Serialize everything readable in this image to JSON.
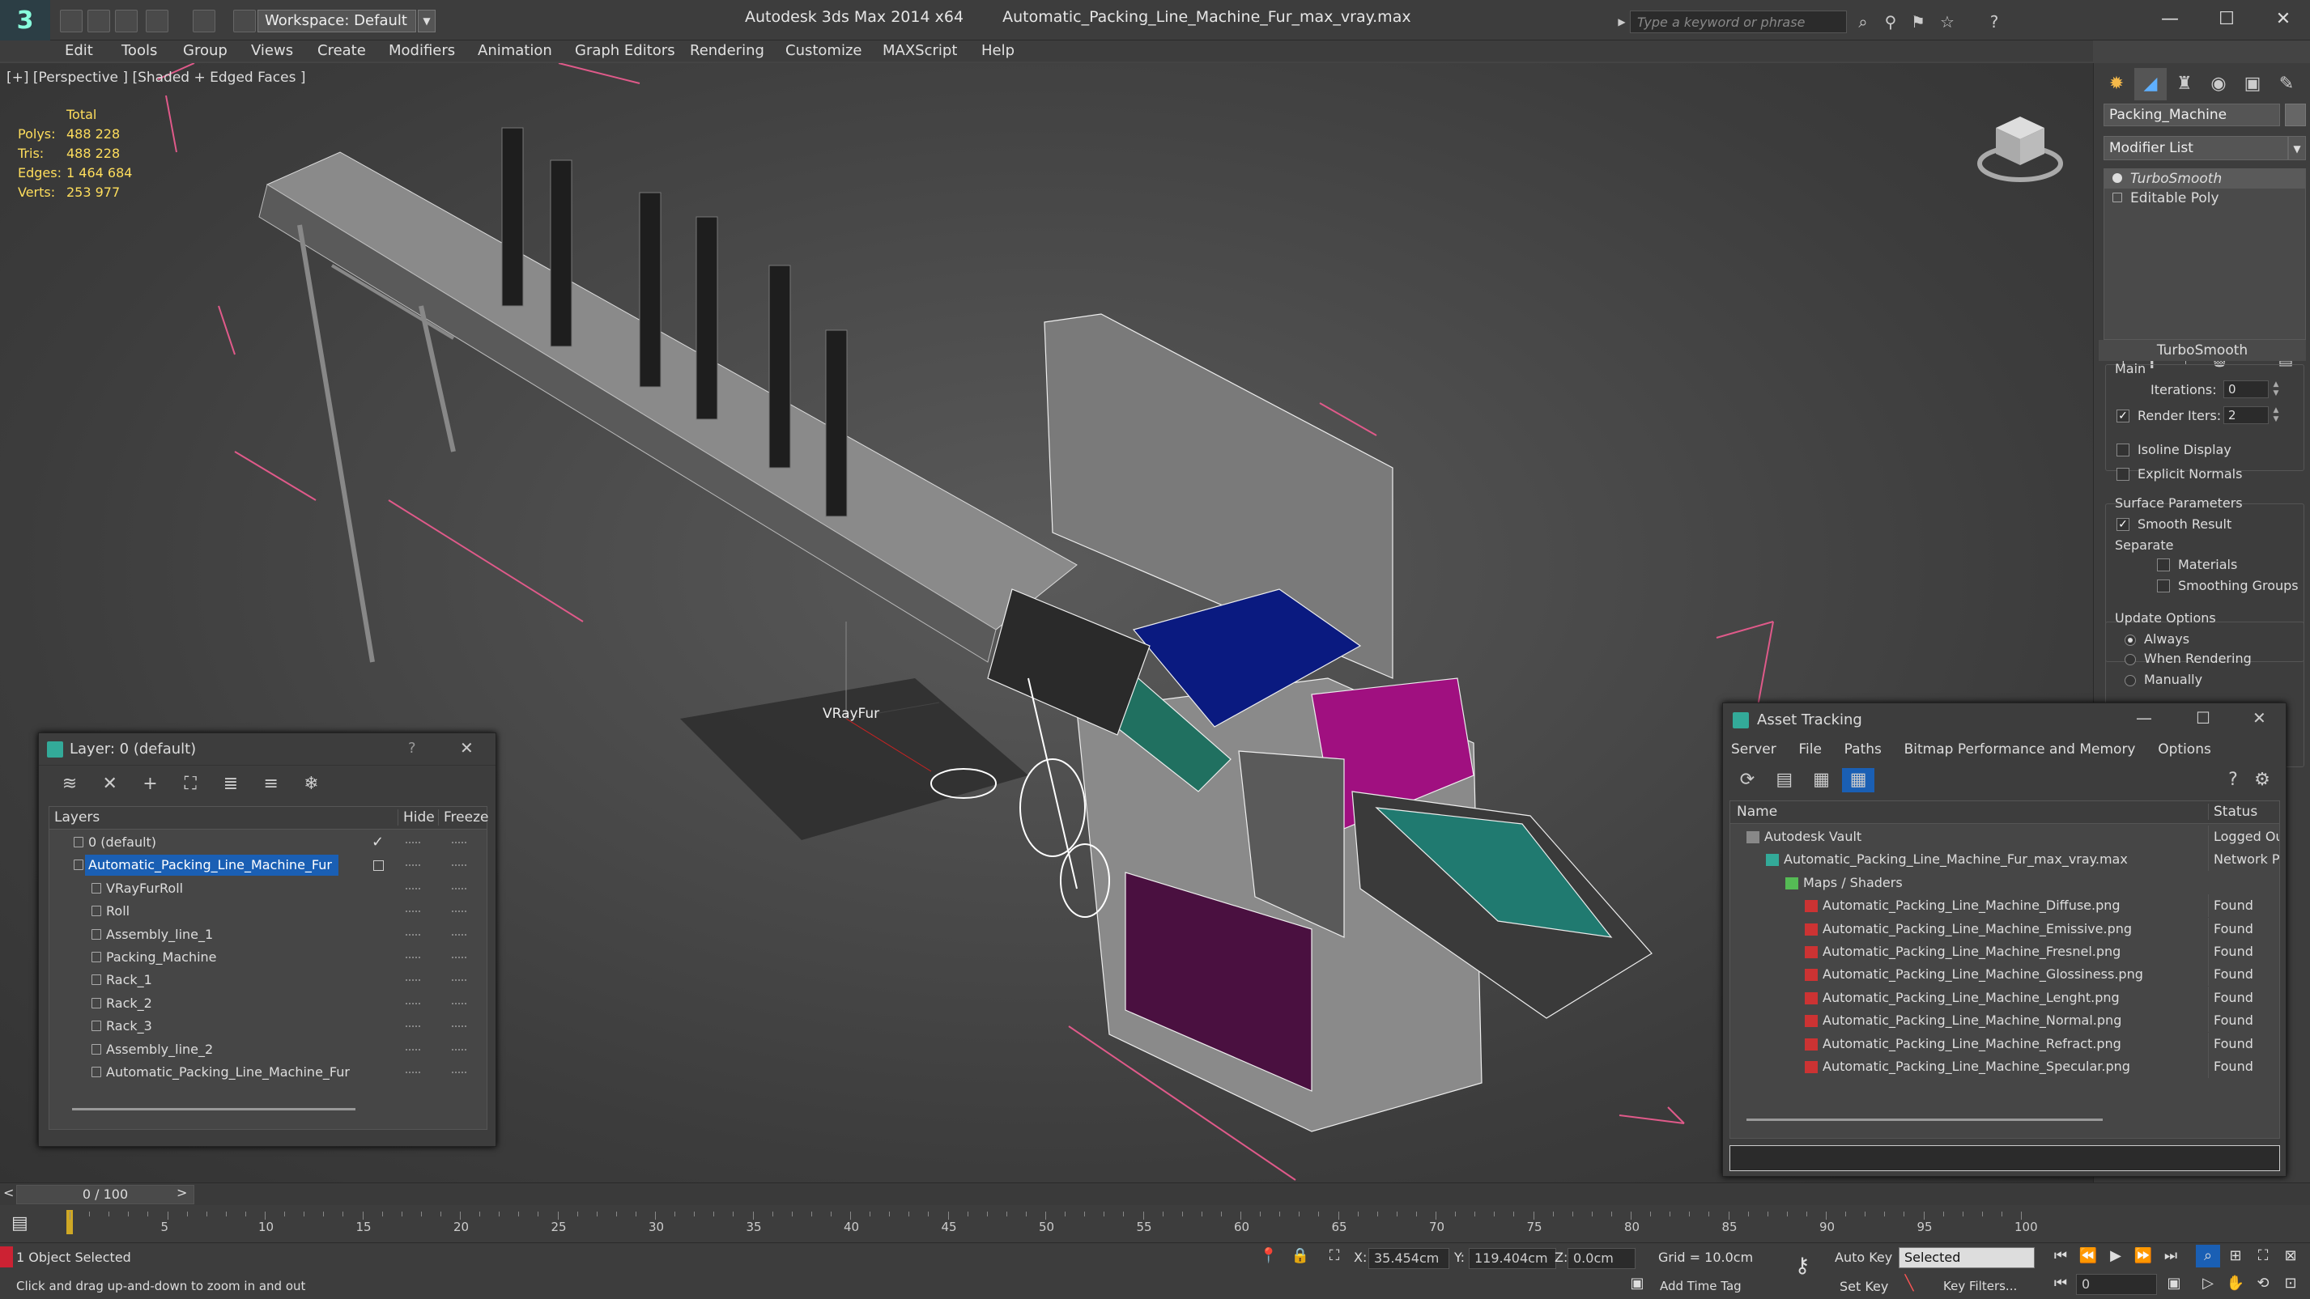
{
  "titlebar": {
    "workspace": "Workspace: Default",
    "app_name": "Autodesk 3ds Max  2014 x64",
    "file_name": "Automatic_Packing_Line_Machine_Fur_max_vray.max",
    "search_placeholder": "Type a keyword or phrase"
  },
  "menu": [
    "Edit",
    "Tools",
    "Group",
    "Views",
    "Create",
    "Modifiers",
    "Animation",
    "Graph Editors",
    "Rendering",
    "Customize",
    "MAXScript",
    "Help"
  ],
  "viewport": {
    "label": "[+] [Perspective ] [Shaded + Edged Faces ]",
    "stats_header": "Total",
    "stats": [
      {
        "k": "Polys:",
        "v": "488 228"
      },
      {
        "k": "Tris:",
        "v": "488 228"
      },
      {
        "k": "Edges:",
        "v": "1 464 684"
      },
      {
        "k": "Verts:",
        "v": "253 977"
      }
    ],
    "object_label": "VRayFur"
  },
  "command_panel": {
    "object_name": "Packing_Machine",
    "modifier_list": "Modifier List",
    "stack": [
      "TurboSmooth",
      "Editable Poly"
    ],
    "rollout_title": "TurboSmooth",
    "main_label": "Main",
    "iterations_label": "Iterations:",
    "iterations_value": "0",
    "render_iters_label": "Render Iters:",
    "render_iters_value": "2",
    "isoline": "Isoline Display",
    "explicit_normals": "Explicit Normals",
    "surface_params": "Surface Parameters",
    "smooth_result": "Smooth Result",
    "separate": "Separate",
    "materials": "Materials",
    "smoothing_groups": "Smoothing Groups",
    "update_options": "Update Options",
    "always": "Always",
    "when_rendering": "When Rendering",
    "manually": "Manually"
  },
  "layer_window": {
    "title": "Layer: 0 (default)",
    "help": "?",
    "col_layers": "Layers",
    "col_hide": "Hide",
    "col_freeze": "Freeze",
    "rows": [
      {
        "name": "0 (default)",
        "indent": 0
      },
      {
        "name": "Automatic_Packing_Line_Machine_Fur",
        "indent": 0
      },
      {
        "name": "VRayFurRoll",
        "indent": 1
      },
      {
        "name": "Roll",
        "indent": 1
      },
      {
        "name": "Assembly_line_1",
        "indent": 1
      },
      {
        "name": "Packing_Machine",
        "indent": 1
      },
      {
        "name": "Rack_1",
        "indent": 1
      },
      {
        "name": "Rack_2",
        "indent": 1
      },
      {
        "name": "Rack_3",
        "indent": 1
      },
      {
        "name": "Assembly_line_2",
        "indent": 1
      },
      {
        "name": "Automatic_Packing_Line_Machine_Fur",
        "indent": 1
      }
    ]
  },
  "asset_window": {
    "title": "Asset Tracking",
    "menu": [
      "Server",
      "File",
      "Paths",
      "Bitmap Performance and Memory",
      "Options"
    ],
    "col_name": "Name",
    "col_status": "Status",
    "rows": [
      {
        "name": "Autodesk Vault",
        "status": "Logged Ou",
        "indent": 0
      },
      {
        "name": "Automatic_Packing_Line_Machine_Fur_max_vray.max",
        "status": "Network Pa",
        "indent": 1
      },
      {
        "name": "Maps / Shaders",
        "status": "",
        "indent": 2
      },
      {
        "name": "Automatic_Packing_Line_Machine_Diffuse.png",
        "status": "Found",
        "indent": 3
      },
      {
        "name": "Automatic_Packing_Line_Machine_Emissive.png",
        "status": "Found",
        "indent": 3
      },
      {
        "name": "Automatic_Packing_Line_Machine_Fresnel.png",
        "status": "Found",
        "indent": 3
      },
      {
        "name": "Automatic_Packing_Line_Machine_Glossiness.png",
        "status": "Found",
        "indent": 3
      },
      {
        "name": "Automatic_Packing_Line_Machine_Lenght.png",
        "status": "Found",
        "indent": 3
      },
      {
        "name": "Automatic_Packing_Line_Machine_Normal.png",
        "status": "Found",
        "indent": 3
      },
      {
        "name": "Automatic_Packing_Line_Machine_Refract.png",
        "status": "Found",
        "indent": 3
      },
      {
        "name": "Automatic_Packing_Line_Machine_Specular.png",
        "status": "Found",
        "indent": 3
      }
    ]
  },
  "timeline": {
    "frame_display": "0 / 100",
    "ticks": [
      "5",
      "10",
      "15",
      "20",
      "25",
      "30",
      "35",
      "40",
      "45",
      "50",
      "55",
      "60",
      "65",
      "70",
      "75",
      "80",
      "85",
      "90",
      "95",
      "100"
    ]
  },
  "statusbar": {
    "selection": "1 Object Selected",
    "prompt": "Click and drag up-and-down to zoom in and out",
    "x_label": "X:",
    "x_value": "35.454cm",
    "y_label": "Y:",
    "y_value": "119.404cm",
    "z_label": "Z:",
    "z_value": "0.0cm",
    "grid": "Grid = 10.0cm",
    "add_time_tag": "Add Time Tag",
    "auto_key": "Auto Key",
    "set_key": "Set Key",
    "selected": "Selected",
    "key_filters": "Key Filters...",
    "frame": "0"
  },
  "colors": {
    "accent_blue": "#1a5fb4",
    "stat_yellow": "#ffde5c",
    "selection_pink": "#e05a8a"
  }
}
